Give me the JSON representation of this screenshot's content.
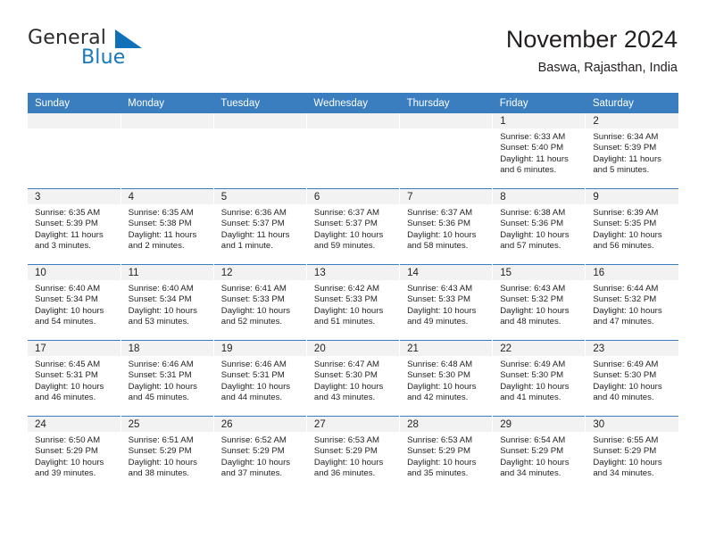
{
  "brand": {
    "name_top": "General",
    "name_bottom": "Blue",
    "triangle_icon": "blue-triangle-icon",
    "accent_color": "#1071b8"
  },
  "header": {
    "title": "November 2024",
    "location": "Baswa, Rajasthan, India"
  },
  "theme": {
    "header_blue": "#3a7ebf",
    "daynum_band": "#f2f2f2",
    "text": "#231f20"
  },
  "calendar": {
    "weekday_headers": [
      "Sunday",
      "Monday",
      "Tuesday",
      "Wednesday",
      "Thursday",
      "Friday",
      "Saturday"
    ],
    "labels": {
      "sunrise": "Sunrise:",
      "sunset": "Sunset:",
      "daylight": "Daylight:"
    },
    "weeks": [
      [
        {
          "day": "",
          "empty": true
        },
        {
          "day": "",
          "empty": true
        },
        {
          "day": "",
          "empty": true
        },
        {
          "day": "",
          "empty": true
        },
        {
          "day": "",
          "empty": true
        },
        {
          "day": "1",
          "sunrise": "Sunrise: 6:33 AM",
          "sunset": "Sunset: 5:40 PM",
          "daylight_line1": "Daylight: 11 hours",
          "daylight_line2": "and 6 minutes."
        },
        {
          "day": "2",
          "sunrise": "Sunrise: 6:34 AM",
          "sunset": "Sunset: 5:39 PM",
          "daylight_line1": "Daylight: 11 hours",
          "daylight_line2": "and 5 minutes."
        }
      ],
      [
        {
          "day": "3",
          "sunrise": "Sunrise: 6:35 AM",
          "sunset": "Sunset: 5:39 PM",
          "daylight_line1": "Daylight: 11 hours",
          "daylight_line2": "and 3 minutes."
        },
        {
          "day": "4",
          "sunrise": "Sunrise: 6:35 AM",
          "sunset": "Sunset: 5:38 PM",
          "daylight_line1": "Daylight: 11 hours",
          "daylight_line2": "and 2 minutes."
        },
        {
          "day": "5",
          "sunrise": "Sunrise: 6:36 AM",
          "sunset": "Sunset: 5:37 PM",
          "daylight_line1": "Daylight: 11 hours",
          "daylight_line2": "and 1 minute."
        },
        {
          "day": "6",
          "sunrise": "Sunrise: 6:37 AM",
          "sunset": "Sunset: 5:37 PM",
          "daylight_line1": "Daylight: 10 hours",
          "daylight_line2": "and 59 minutes."
        },
        {
          "day": "7",
          "sunrise": "Sunrise: 6:37 AM",
          "sunset": "Sunset: 5:36 PM",
          "daylight_line1": "Daylight: 10 hours",
          "daylight_line2": "and 58 minutes."
        },
        {
          "day": "8",
          "sunrise": "Sunrise: 6:38 AM",
          "sunset": "Sunset: 5:36 PM",
          "daylight_line1": "Daylight: 10 hours",
          "daylight_line2": "and 57 minutes."
        },
        {
          "day": "9",
          "sunrise": "Sunrise: 6:39 AM",
          "sunset": "Sunset: 5:35 PM",
          "daylight_line1": "Daylight: 10 hours",
          "daylight_line2": "and 56 minutes."
        }
      ],
      [
        {
          "day": "10",
          "sunrise": "Sunrise: 6:40 AM",
          "sunset": "Sunset: 5:34 PM",
          "daylight_line1": "Daylight: 10 hours",
          "daylight_line2": "and 54 minutes."
        },
        {
          "day": "11",
          "sunrise": "Sunrise: 6:40 AM",
          "sunset": "Sunset: 5:34 PM",
          "daylight_line1": "Daylight: 10 hours",
          "daylight_line2": "and 53 minutes."
        },
        {
          "day": "12",
          "sunrise": "Sunrise: 6:41 AM",
          "sunset": "Sunset: 5:33 PM",
          "daylight_line1": "Daylight: 10 hours",
          "daylight_line2": "and 52 minutes."
        },
        {
          "day": "13",
          "sunrise": "Sunrise: 6:42 AM",
          "sunset": "Sunset: 5:33 PM",
          "daylight_line1": "Daylight: 10 hours",
          "daylight_line2": "and 51 minutes."
        },
        {
          "day": "14",
          "sunrise": "Sunrise: 6:43 AM",
          "sunset": "Sunset: 5:33 PM",
          "daylight_line1": "Daylight: 10 hours",
          "daylight_line2": "and 49 minutes."
        },
        {
          "day": "15",
          "sunrise": "Sunrise: 6:43 AM",
          "sunset": "Sunset: 5:32 PM",
          "daylight_line1": "Daylight: 10 hours",
          "daylight_line2": "and 48 minutes."
        },
        {
          "day": "16",
          "sunrise": "Sunrise: 6:44 AM",
          "sunset": "Sunset: 5:32 PM",
          "daylight_line1": "Daylight: 10 hours",
          "daylight_line2": "and 47 minutes."
        }
      ],
      [
        {
          "day": "17",
          "sunrise": "Sunrise: 6:45 AM",
          "sunset": "Sunset: 5:31 PM",
          "daylight_line1": "Daylight: 10 hours",
          "daylight_line2": "and 46 minutes."
        },
        {
          "day": "18",
          "sunrise": "Sunrise: 6:46 AM",
          "sunset": "Sunset: 5:31 PM",
          "daylight_line1": "Daylight: 10 hours",
          "daylight_line2": "and 45 minutes."
        },
        {
          "day": "19",
          "sunrise": "Sunrise: 6:46 AM",
          "sunset": "Sunset: 5:31 PM",
          "daylight_line1": "Daylight: 10 hours",
          "daylight_line2": "and 44 minutes."
        },
        {
          "day": "20",
          "sunrise": "Sunrise: 6:47 AM",
          "sunset": "Sunset: 5:30 PM",
          "daylight_line1": "Daylight: 10 hours",
          "daylight_line2": "and 43 minutes."
        },
        {
          "day": "21",
          "sunrise": "Sunrise: 6:48 AM",
          "sunset": "Sunset: 5:30 PM",
          "daylight_line1": "Daylight: 10 hours",
          "daylight_line2": "and 42 minutes."
        },
        {
          "day": "22",
          "sunrise": "Sunrise: 6:49 AM",
          "sunset": "Sunset: 5:30 PM",
          "daylight_line1": "Daylight: 10 hours",
          "daylight_line2": "and 41 minutes."
        },
        {
          "day": "23",
          "sunrise": "Sunrise: 6:49 AM",
          "sunset": "Sunset: 5:30 PM",
          "daylight_line1": "Daylight: 10 hours",
          "daylight_line2": "and 40 minutes."
        }
      ],
      [
        {
          "day": "24",
          "sunrise": "Sunrise: 6:50 AM",
          "sunset": "Sunset: 5:29 PM",
          "daylight_line1": "Daylight: 10 hours",
          "daylight_line2": "and 39 minutes."
        },
        {
          "day": "25",
          "sunrise": "Sunrise: 6:51 AM",
          "sunset": "Sunset: 5:29 PM",
          "daylight_line1": "Daylight: 10 hours",
          "daylight_line2": "and 38 minutes."
        },
        {
          "day": "26",
          "sunrise": "Sunrise: 6:52 AM",
          "sunset": "Sunset: 5:29 PM",
          "daylight_line1": "Daylight: 10 hours",
          "daylight_line2": "and 37 minutes."
        },
        {
          "day": "27",
          "sunrise": "Sunrise: 6:53 AM",
          "sunset": "Sunset: 5:29 PM",
          "daylight_line1": "Daylight: 10 hours",
          "daylight_line2": "and 36 minutes."
        },
        {
          "day": "28",
          "sunrise": "Sunrise: 6:53 AM",
          "sunset": "Sunset: 5:29 PM",
          "daylight_line1": "Daylight: 10 hours",
          "daylight_line2": "and 35 minutes."
        },
        {
          "day": "29",
          "sunrise": "Sunrise: 6:54 AM",
          "sunset": "Sunset: 5:29 PM",
          "daylight_line1": "Daylight: 10 hours",
          "daylight_line2": "and 34 minutes."
        },
        {
          "day": "30",
          "sunrise": "Sunrise: 6:55 AM",
          "sunset": "Sunset: 5:29 PM",
          "daylight_line1": "Daylight: 10 hours",
          "daylight_line2": "and 34 minutes."
        }
      ]
    ]
  }
}
